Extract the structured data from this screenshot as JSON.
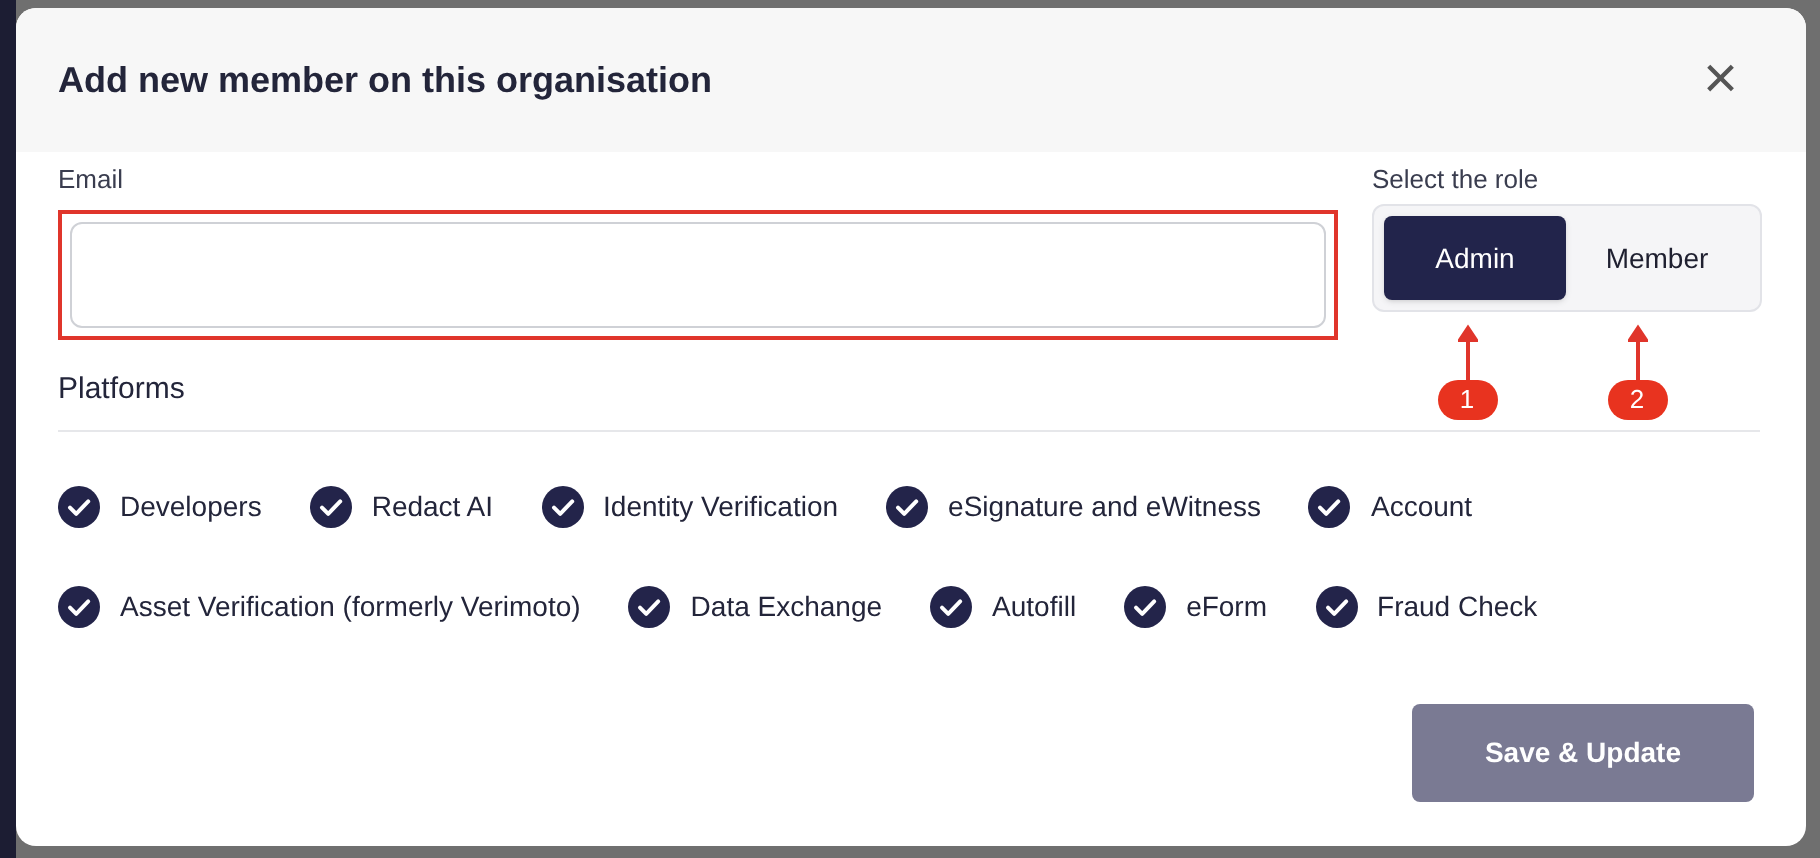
{
  "dialog": {
    "title": "Add new member on this organisation",
    "close_label": "×"
  },
  "email": {
    "label": "Email",
    "highlighted": true
  },
  "role": {
    "label": "Select the role",
    "options": [
      {
        "label": "Admin",
        "selected": true
      },
      {
        "label": "Member",
        "selected": false
      }
    ]
  },
  "annotations": [
    {
      "label": "1"
    },
    {
      "label": "2"
    }
  ],
  "platforms": {
    "title": "Platforms",
    "items": [
      {
        "label": "Developers",
        "checked": true
      },
      {
        "label": "Redact AI",
        "checked": true
      },
      {
        "label": "Identity Verification",
        "checked": true
      },
      {
        "label": "eSignature and eWitness",
        "checked": true
      },
      {
        "label": "Account",
        "checked": true
      },
      {
        "label": "Asset Verification (formerly Verimoto)",
        "checked": true
      },
      {
        "label": "Data Exchange",
        "checked": true
      },
      {
        "label": "Autofill",
        "checked": true
      },
      {
        "label": "eForm",
        "checked": true
      },
      {
        "label": "Fraud Check",
        "checked": true
      }
    ]
  },
  "save_button": {
    "label": "Save & Update",
    "disabled": true
  }
}
